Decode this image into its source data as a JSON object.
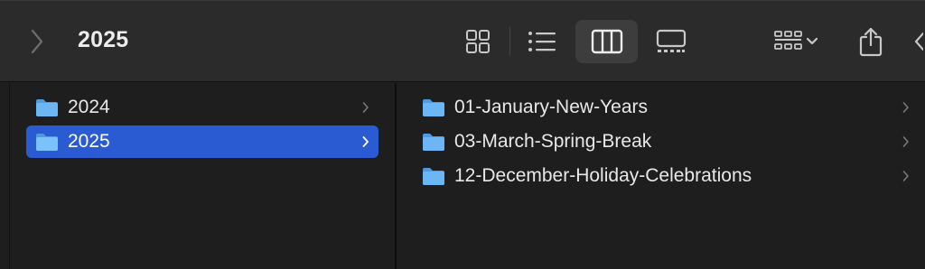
{
  "toolbar": {
    "title": "2025",
    "icons": [
      "back-chevron-icon",
      "icon-view-icon",
      "list-view-icon",
      "column-view-icon",
      "gallery-view-icon",
      "group-by-icon",
      "chevron-down-icon",
      "share-icon",
      "tag-icon"
    ],
    "active_view": "column"
  },
  "columns": {
    "left": {
      "items": [
        {
          "label": "2024",
          "selected": false
        },
        {
          "label": "2025",
          "selected": true
        }
      ]
    },
    "right": {
      "items": [
        {
          "label": "01-January-New-Years"
        },
        {
          "label": "03-March-Spring-Break"
        },
        {
          "label": "12-December-Holiday-Celebrations"
        }
      ]
    }
  },
  "colors": {
    "selection": "#2a5bd3",
    "folder": "#5aaaf0",
    "toolbar_bg": "#2b2b2b",
    "pane_bg": "#1e1e1e"
  }
}
